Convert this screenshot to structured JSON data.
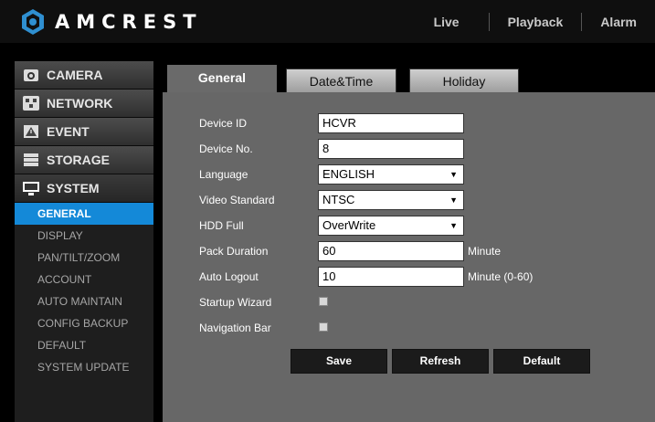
{
  "header": {
    "logo_text": "AMCREST",
    "nav": [
      "Live",
      "Playback",
      "Alarm"
    ]
  },
  "sidebar": {
    "sections": [
      {
        "label": "CAMERA",
        "icon": "camera-icon"
      },
      {
        "label": "NETWORK",
        "icon": "network-icon"
      },
      {
        "label": "EVENT",
        "icon": "event-icon"
      },
      {
        "label": "STORAGE",
        "icon": "storage-icon"
      },
      {
        "label": "SYSTEM",
        "icon": "monitor-icon"
      }
    ],
    "system_items": [
      "GENERAL",
      "DISPLAY",
      "PAN/TILT/ZOOM",
      "ACCOUNT",
      "AUTO MAINTAIN",
      "CONFIG BACKUP",
      "DEFAULT",
      "SYSTEM UPDATE"
    ],
    "selected_item": "GENERAL"
  },
  "tabs": [
    "General",
    "Date&Time",
    "Holiday"
  ],
  "active_tab": "General",
  "form": {
    "device_id": {
      "label": "Device ID",
      "value": "HCVR"
    },
    "device_no": {
      "label": "Device No.",
      "value": "8"
    },
    "language": {
      "label": "Language",
      "value": "ENGLISH"
    },
    "video_standard": {
      "label": "Video Standard",
      "value": "NTSC"
    },
    "hdd_full": {
      "label": "HDD Full",
      "value": "OverWrite"
    },
    "pack_duration": {
      "label": "Pack Duration",
      "value": "60",
      "unit": "Minute"
    },
    "auto_logout": {
      "label": "Auto Logout",
      "value": "10",
      "unit": "Minute (0-60)"
    },
    "startup_wizard": {
      "label": "Startup Wizard",
      "checked": false
    },
    "navigation_bar": {
      "label": "Navigation Bar",
      "checked": false
    }
  },
  "buttons": {
    "save": "Save",
    "refresh": "Refresh",
    "default": "Default"
  },
  "colors": {
    "accent": "#1489d8",
    "panel": "#676767",
    "logo": "#2f8fd0"
  }
}
